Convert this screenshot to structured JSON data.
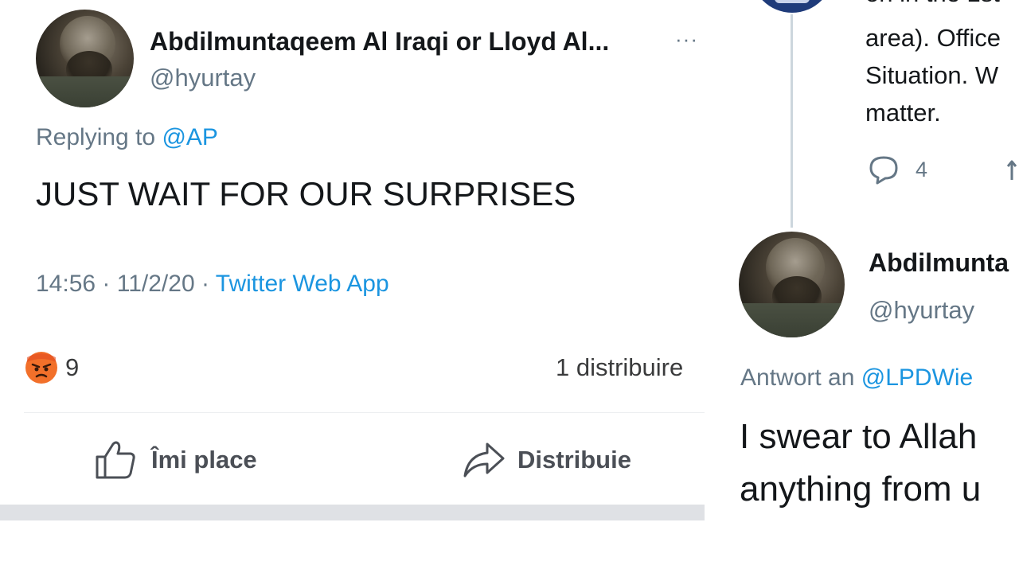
{
  "left": {
    "author_name": "Abdilmuntaqeem Al Iraqi or Lloyd Al...",
    "author_handle": "@hyurtay",
    "more": "···",
    "replying_prefix": "Replying to",
    "replying_handle": "@AP",
    "tweet_text": "JUST WAIT FOR OUR SURPRISES",
    "time": "14:56",
    "date": "11/2/20",
    "separator": "·",
    "source": "Twitter Web App",
    "reaction_count": "9",
    "shares": "1 distribuire",
    "like_label": "Îmi place",
    "share_label": "Distribuie"
  },
  "right": {
    "top_partial_line": "on in the 1st",
    "top_lines": [
      "area). Office",
      "Situation. W",
      "matter."
    ],
    "reply_count": "4",
    "author_name": "Abdilmunta",
    "author_handle": "@hyurtay",
    "replying_prefix": "Antwort an",
    "replying_handle": "@LPDWie",
    "tweet_lines": [
      "I swear to Allah",
      "anything from u"
    ]
  },
  "colors": {
    "link": "#1b95e0",
    "muted": "#657786",
    "text": "#14171a",
    "angry": "#f2702a",
    "divider_bar": "#dfe1e5"
  }
}
